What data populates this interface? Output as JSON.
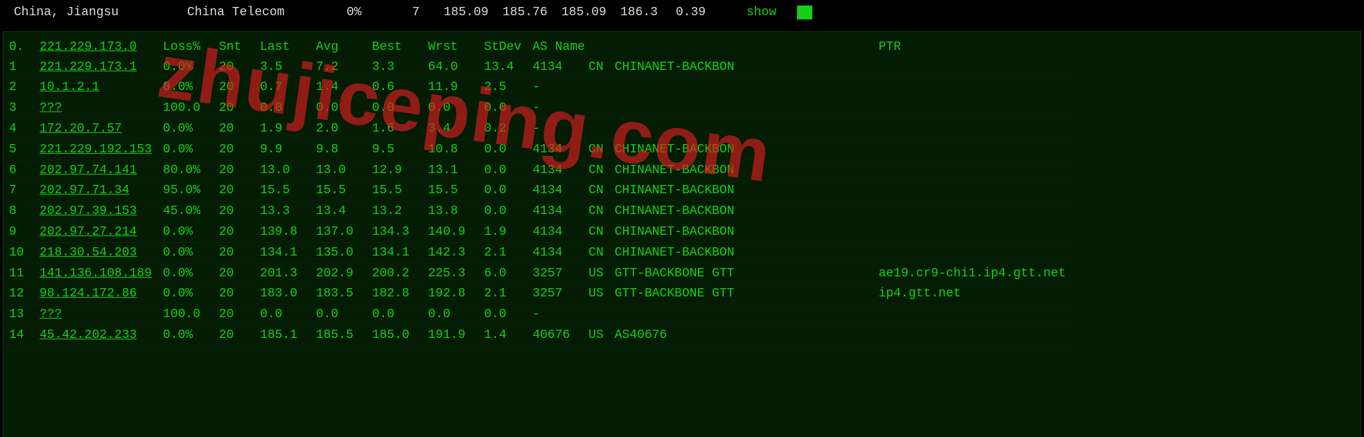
{
  "topbar": {
    "location": "China, Jiangsu",
    "isp": "China Telecom",
    "loss": "0%",
    "snt": "7",
    "v1": "185.09",
    "v2": "185.76",
    "v3": "185.09",
    "v4": "186.3",
    "v5": "0.39",
    "show": "show"
  },
  "headers": {
    "idx": "0.",
    "host": "221.229.173.0",
    "loss": "Loss%",
    "snt": "Snt",
    "last": "Last",
    "avg": "Avg",
    "best": "Best",
    "wrst": "Wrst",
    "stdev": "StDev",
    "asname": "AS Name",
    "ptr": "PTR"
  },
  "rows": [
    {
      "idx": "1",
      "host": "221.229.173.1",
      "loss": "0.0%",
      "snt": "20",
      "last": "3.5",
      "avg": "7.2",
      "best": "3.3",
      "wrst": "64.0",
      "stdev": "13.4",
      "as": "4134",
      "cc": "CN",
      "name": "CHINANET-BACKBON",
      "ptr": ""
    },
    {
      "idx": "2",
      "host": "10.1.2.1",
      "loss": "0.0%",
      "snt": "20",
      "last": "0.7",
      "avg": "1.4",
      "best": "0.6",
      "wrst": "11.9",
      "stdev": "2.5",
      "as": "-",
      "cc": "",
      "name": "",
      "ptr": ""
    },
    {
      "idx": "3",
      "host": "???",
      "loss": "100.0",
      "snt": "20",
      "last": "0.0",
      "avg": "0.0",
      "best": "0.0",
      "wrst": "0.0",
      "stdev": "0.0",
      "as": "-",
      "cc": "",
      "name": "",
      "ptr": ""
    },
    {
      "idx": "4",
      "host": "172.20.7.57",
      "loss": "0.0%",
      "snt": "20",
      "last": "1.9",
      "avg": "2.0",
      "best": "1.6",
      "wrst": "3.4",
      "stdev": "0.2",
      "as": "-",
      "cc": "",
      "name": "",
      "ptr": ""
    },
    {
      "idx": "5",
      "host": "221.229.192.153",
      "loss": "0.0%",
      "snt": "20",
      "last": "9.9",
      "avg": "9.8",
      "best": "9.5",
      "wrst": "10.8",
      "stdev": "0.0",
      "as": "4134",
      "cc": "CN",
      "name": "CHINANET-BACKBON",
      "ptr": ""
    },
    {
      "idx": "6",
      "host": "202.97.74.141",
      "loss": "80.0%",
      "snt": "20",
      "last": "13.0",
      "avg": "13.0",
      "best": "12.9",
      "wrst": "13.1",
      "stdev": "0.0",
      "as": "4134",
      "cc": "CN",
      "name": "CHINANET-BACKBON",
      "ptr": ""
    },
    {
      "idx": "7",
      "host": "202.97.71.34",
      "loss": "95.0%",
      "snt": "20",
      "last": "15.5",
      "avg": "15.5",
      "best": "15.5",
      "wrst": "15.5",
      "stdev": "0.0",
      "as": "4134",
      "cc": "CN",
      "name": "CHINANET-BACKBON",
      "ptr": ""
    },
    {
      "idx": "8",
      "host": "202.97.39.153",
      "loss": "45.0%",
      "snt": "20",
      "last": "13.3",
      "avg": "13.4",
      "best": "13.2",
      "wrst": "13.8",
      "stdev": "0.0",
      "as": "4134",
      "cc": "CN",
      "name": "CHINANET-BACKBON",
      "ptr": ""
    },
    {
      "idx": "9",
      "host": "202.97.27.214",
      "loss": "0.0%",
      "snt": "20",
      "last": "139.8",
      "avg": "137.0",
      "best": "134.3",
      "wrst": "140.9",
      "stdev": "1.9",
      "as": "4134",
      "cc": "CN",
      "name": "CHINANET-BACKBON",
      "ptr": ""
    },
    {
      "idx": "10",
      "host": "218.30.54.203",
      "loss": "0.0%",
      "snt": "20",
      "last": "134.1",
      "avg": "135.0",
      "best": "134.1",
      "wrst": "142.3",
      "stdev": "2.1",
      "as": "4134",
      "cc": "CN",
      "name": "CHINANET-BACKBON",
      "ptr": ""
    },
    {
      "idx": "11",
      "host": "141.136.108.189",
      "loss": "0.0%",
      "snt": "20",
      "last": "201.3",
      "avg": "202.9",
      "best": "200.2",
      "wrst": "225.3",
      "stdev": "6.0",
      "as": "3257",
      "cc": "US",
      "name": "GTT-BACKBONE GTT",
      "ptr": "ae19.cr9-chi1.ip4.gtt.net"
    },
    {
      "idx": "12",
      "host": "98.124.172.86",
      "loss": "0.0%",
      "snt": "20",
      "last": "183.0",
      "avg": "183.5",
      "best": "182.8",
      "wrst": "192.8",
      "stdev": "2.1",
      "as": "3257",
      "cc": "US",
      "name": "GTT-BACKBONE GTT",
      "ptr": "ip4.gtt.net"
    },
    {
      "idx": "13",
      "host": "???",
      "loss": "100.0",
      "snt": "20",
      "last": "0.0",
      "avg": "0.0",
      "best": "0.0",
      "wrst": "0.0",
      "stdev": "0.0",
      "as": "-",
      "cc": "",
      "name": "",
      "ptr": ""
    },
    {
      "idx": "14",
      "host": "45.42.202.233",
      "loss": "0.0%",
      "snt": "20",
      "last": "185.1",
      "avg": "185.5",
      "best": "185.0",
      "wrst": "191.9",
      "stdev": "1.4",
      "as": "40676",
      "cc": "US",
      "name": "AS40676",
      "ptr": ""
    }
  ],
  "watermark": "zhujiceping.com"
}
